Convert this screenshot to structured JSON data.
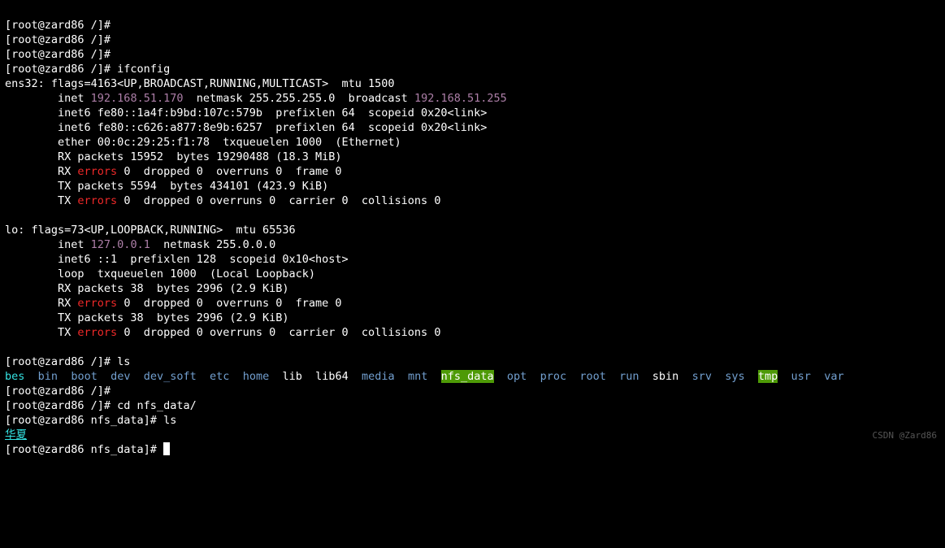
{
  "sep": "  ",
  "R": {
    "0": "[root@zard86 /]#",
    "1": "[root@zard86 /]#",
    "2": "[root@zard86 /]#",
    "3": "[root@zard86 /]# ifconfig",
    "4": "ens32: flags=4163<UP,BROADCAST,RUNNING,MULTICAST>  mtu 1500",
    "5a": "        inet ",
    "5b": "192.168.51.170",
    "5c": "  netmask 255.255.255.0  broadcast ",
    "5d": "192.168.51.255",
    "6": "        inet6 fe80::1a4f:b9bd:107c:579b  prefixlen 64  scopeid 0x20<link>",
    "7": "        inet6 fe80::c626:a877:8e9b:6257  prefixlen 64  scopeid 0x20<link>",
    "8": "        ether 00:0c:29:25:f1:78  txqueuelen 1000  (Ethernet)",
    "9": "        RX packets 15952  bytes 19290488 (18.3 MiB)",
    "10a": "        RX ",
    "10b": " 0  dropped 0  overruns 0  frame 0",
    "11": "        TX packets 5594  bytes 434101 (423.9 KiB)",
    "12a": "        TX ",
    "12b": " 0  dropped 0 overruns 0  carrier 0  collisions 0",
    "13": "",
    "14": "lo: flags=73<UP,LOOPBACK,RUNNING>  mtu 65536",
    "15a": "        inet ",
    "15b": "127.0.0.1",
    "15c": "  netmask 255.0.0.0",
    "16": "        inet6 ::1  prefixlen 128  scopeid 0x10<host>",
    "17": "        loop  txqueuelen 1000  (Local Loopback)",
    "18": "        RX packets 38  bytes 2996 (2.9 KiB)",
    "19a": "        RX ",
    "19b": " 0  dropped 0  overruns 0  frame 0",
    "20": "        TX packets 38  bytes 2996 (2.9 KiB)",
    "21a": "        TX ",
    "21b": " 0  dropped 0 overruns 0  carrier 0  collisions 0",
    "22": "",
    "23": "[root@zard86 /]# ls",
    "24": "[root@zard86 /]#",
    "25": "[root@zard86 /]# cd nfs_data/",
    "26": "[root@zard86 nfs_data]# ls",
    "27": "华夏",
    "28": "[root@zard86 nfs_data]# ",
    "err": "errors"
  },
  "ls": [
    "bes",
    "bin",
    "boot",
    "dev",
    "dev_soft",
    "etc",
    "home",
    "lib",
    "lib64",
    "media",
    "mnt",
    "nfs_data",
    "opt",
    "proc",
    "root",
    "run",
    "sbin",
    "srv",
    "sys",
    "tmp",
    "usr",
    "var"
  ],
  "wm": "CSDN @Zard86"
}
